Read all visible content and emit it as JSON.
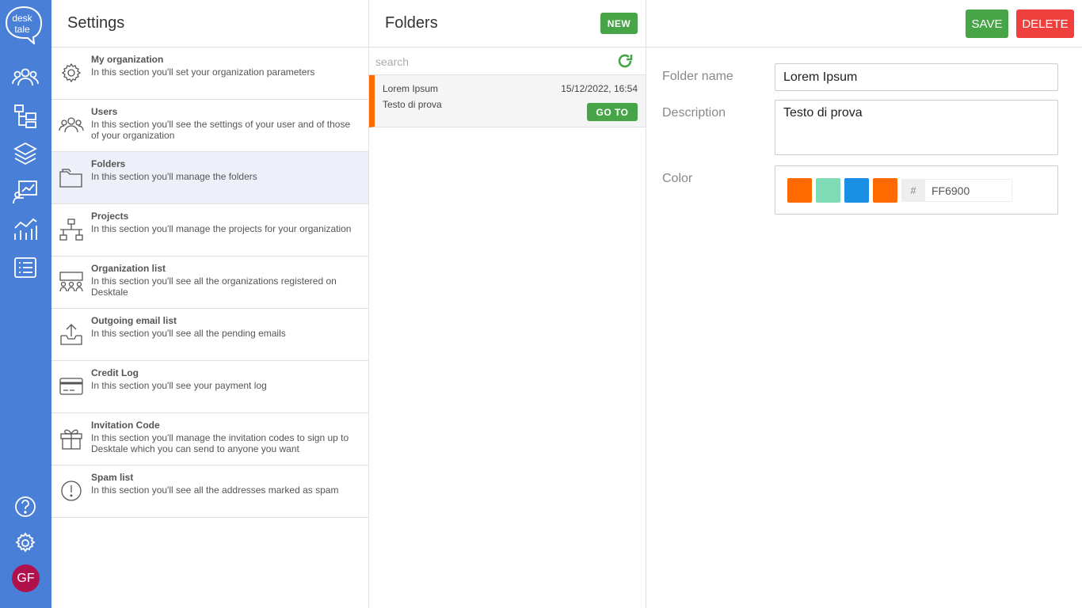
{
  "app": {
    "logo_text_line1": "desk",
    "logo_text_line2": "tale",
    "avatar_initials": "GF"
  },
  "rail": {
    "icons": [
      "users-icon",
      "org-tree-icon",
      "layers-icon",
      "chart-presentation-icon",
      "analytics-icon",
      "list-icon"
    ],
    "bottom_icons": [
      "help-icon",
      "gear-icon"
    ],
    "color": "#4a7fd8"
  },
  "settings": {
    "title": "Settings",
    "items": [
      {
        "title": "My organization",
        "desc": "In this section you'll set your organization parameters",
        "icon": "gear-icon"
      },
      {
        "title": "Users",
        "desc": "In this section you'll see the settings of your user and of those of your organization",
        "icon": "users-icon"
      },
      {
        "title": "Folders",
        "desc": "In this section you'll manage the folders",
        "icon": "folder-icon",
        "active": true
      },
      {
        "title": "Projects",
        "desc": "In this section you'll manage the projects for your organization",
        "icon": "sitemap-icon"
      },
      {
        "title": "Organization list",
        "desc": "In this section you'll see all the organizations registered on Desktale",
        "icon": "organization-list-icon"
      },
      {
        "title": "Outgoing email list",
        "desc": "In this section you'll see all the pending emails",
        "icon": "outbox-icon"
      },
      {
        "title": "Credit Log",
        "desc": "In this section you'll see your payment log",
        "icon": "credit-card-icon"
      },
      {
        "title": "Invitation Code",
        "desc": "In this section you'll manage the invitation codes to sign up to Desktale which you can send to anyone you want",
        "icon": "gift-icon"
      },
      {
        "title": "Spam list",
        "desc": "In this section you'll see all the addresses marked as spam",
        "icon": "alert-circle-icon"
      }
    ]
  },
  "folders": {
    "title": "Folders",
    "new_label": "NEW",
    "search_placeholder": "search",
    "items": [
      {
        "name": "Lorem Ipsum",
        "date": "15/12/2022, 16:54",
        "desc": "Testo di prova",
        "goto_label": "GO TO",
        "color": "#ff6a00"
      }
    ]
  },
  "detail": {
    "save_label": "SAVE",
    "delete_label": "DELETE",
    "name_label": "Folder name",
    "name_value": "Lorem Ipsum",
    "desc_label": "Description",
    "desc_value": "Testo di prova",
    "color_label": "Color",
    "swatches": [
      "#ff6a00",
      "#7fdbb6",
      "#1a8fe3",
      "#ff6a00"
    ],
    "hex_prefix": "#",
    "hex_value": "FF6900"
  }
}
